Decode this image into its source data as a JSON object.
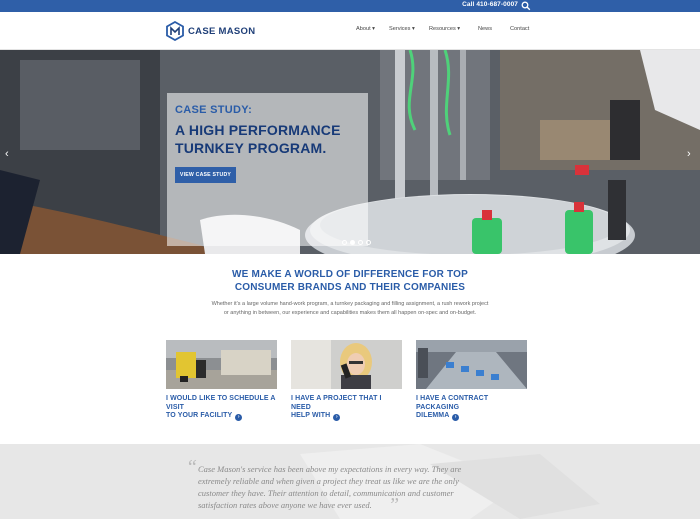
{
  "topbar": {
    "call_text": "Call 410-687-0007"
  },
  "brand": {
    "name": "CASE MASON"
  },
  "nav": [
    {
      "label": "About ▾"
    },
    {
      "label": "Services ▾"
    },
    {
      "label": "Resources ▾"
    },
    {
      "label": "News"
    },
    {
      "label": "Contact"
    }
  ],
  "hero": {
    "eyebrow": "CASE STUDY:",
    "headline_line1": "A HIGH PERFORMANCE",
    "headline_line2": "TURNKEY PROGRAM.",
    "cta": "VIEW CASE STUDY",
    "prev_arrow": "‹",
    "next_arrow": "›"
  },
  "intro": {
    "title_line1": "WE MAKE A WORLD OF DIFFERENCE FOR TOP",
    "title_line2": "CONSUMER BRANDS AND THEIR COMPANIES",
    "text_line1": "Whether it's a large volume hand-work program, a turnkey packaging and filling assignment, a rush rework project",
    "text_line2": "or anything in between, our experience and capabilities makes them all happen on-spec and on-budget."
  },
  "cards": [
    {
      "line1": "I WOULD LIKE TO SCHEDULE A VISIT",
      "line2": "TO YOUR FACILITY"
    },
    {
      "line1": "I HAVE A PROJECT THAT I NEED",
      "line2": "HELP WITH"
    },
    {
      "line1": "I HAVE A CONTRACT PACKAGING",
      "line2": "DILEMMA"
    }
  ],
  "testimonial": {
    "line1": "Case Mason's service has been above my expectations in every way. They are",
    "line2": "extremely reliable and when given a project they treat us like we are the only",
    "line3": "customer they have. Their attention to detail, communication and customer",
    "line4": "satisfaction rates above anyone we have ever used."
  },
  "colors": {
    "brand_blue": "#2f5fa8",
    "dark_blue": "#173a78",
    "testimonial_bg": "#e7e7e7"
  },
  "icons": {
    "search": "search-icon",
    "logo": "hexagon-cm-logo-icon",
    "link": "arrow-circle-icon"
  }
}
